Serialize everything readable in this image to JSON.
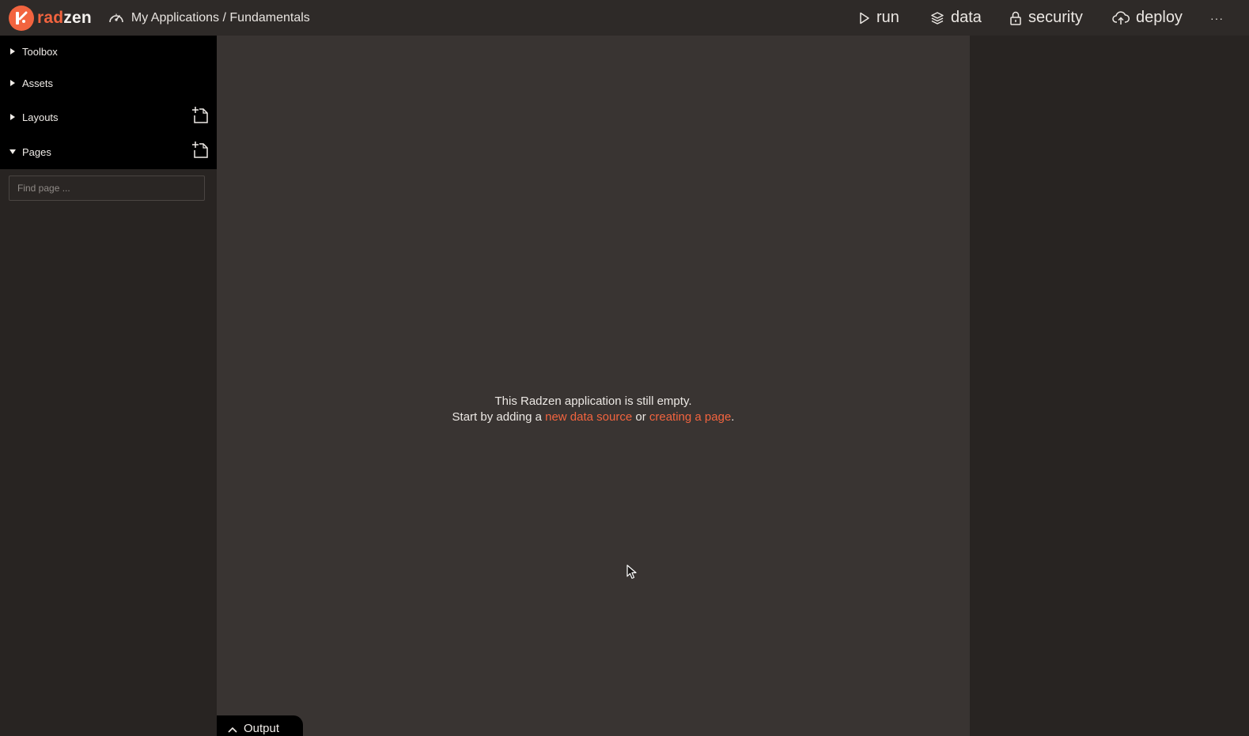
{
  "brand": {
    "rad": "rad",
    "zen": "zen",
    "accent_color": "#f2643f"
  },
  "breadcrumb": {
    "icon": "dashboard-gauge-icon",
    "text": "My Applications / Fundamentals"
  },
  "nav": {
    "run": "run",
    "data": "data",
    "security": "security",
    "deploy": "deploy",
    "more": "···"
  },
  "sidebar": {
    "items": [
      {
        "label": "Toolbox",
        "expanded": false
      },
      {
        "label": "Assets",
        "expanded": false
      },
      {
        "label": "Layouts",
        "expanded": false
      },
      {
        "label": "Pages",
        "expanded": true
      }
    ],
    "search_placeholder": "Find page ..."
  },
  "canvas": {
    "line1": "This Radzen application is still empty.",
    "line2_prefix": "Start by adding a ",
    "link_data_source": "new data source",
    "line2_middle": " or ",
    "link_create_page": "creating a page",
    "line2_suffix": "."
  },
  "output": {
    "label": "Output"
  }
}
